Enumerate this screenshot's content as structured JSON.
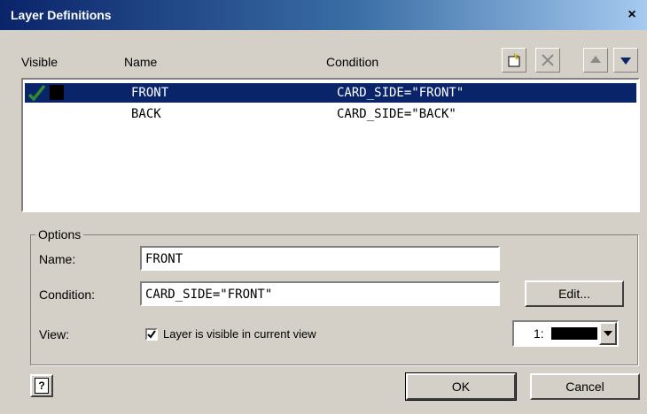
{
  "window": {
    "title": "Layer Definitions",
    "close_glyph": "×"
  },
  "columns": {
    "visible": "Visible",
    "name": "Name",
    "condition": "Condition"
  },
  "toolbar": [
    "new-layer-icon",
    "delete-layer-icon",
    "move-up-icon",
    "move-down-icon"
  ],
  "layers": [
    {
      "name": "FRONT",
      "condition": "CARD_SIDE=\"FRONT\"",
      "visible": true,
      "selected": true,
      "color": "#000000"
    },
    {
      "name": "BACK",
      "condition": "CARD_SIDE=\"BACK\"",
      "visible": false,
      "selected": false
    }
  ],
  "options": {
    "group_label": "Options",
    "name_label": "Name:",
    "name_value": "FRONT",
    "condition_label": "Condition:",
    "condition_value": "CARD_SIDE=\"FRONT\"",
    "edit_label": "Edit...",
    "view_label": "View:",
    "visible_checkbox_label": "Layer is visible in current view",
    "visible_checked": true,
    "view_select_value": "1:",
    "view_select_color": "#000000"
  },
  "footer": {
    "help_glyph": "?",
    "ok_label": "OK",
    "cancel_label": "Cancel"
  },
  "colors": {
    "selection": "#0a246a",
    "dialog": "#d4d0c8",
    "check": "#2e8b2e"
  }
}
